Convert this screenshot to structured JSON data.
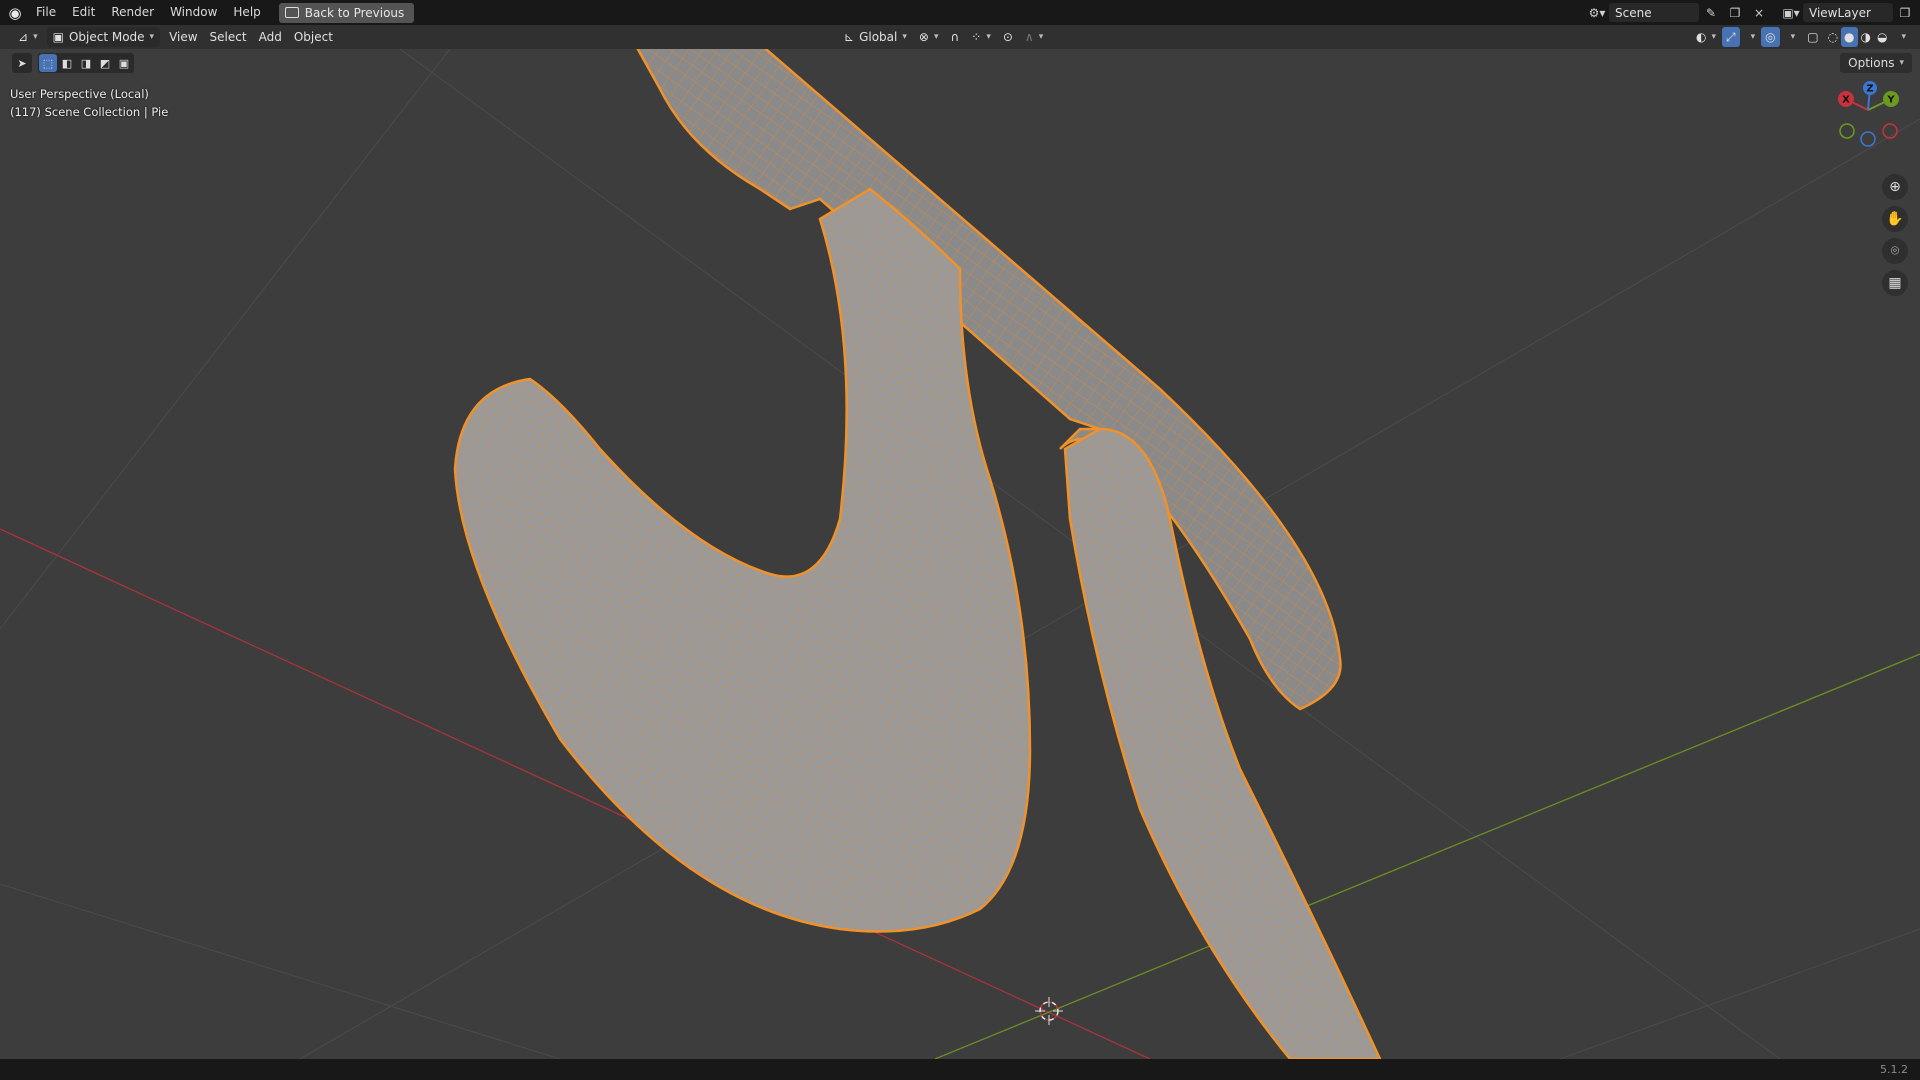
{
  "topbar": {
    "menus": [
      "File",
      "Edit",
      "Render",
      "Window",
      "Help"
    ],
    "back_label": "Back to Previous",
    "scene_label": "Scene",
    "viewlayer_label": "ViewLayer"
  },
  "header": {
    "mode_label": "Object Mode",
    "menus": [
      "View",
      "Select",
      "Add",
      "Object"
    ],
    "orientation_label": "Global",
    "options_label": "Options"
  },
  "overlay_info": {
    "perspective": "User Perspective (Local)",
    "collection": "(117) Scene Collection | Pie"
  },
  "gizmo": {
    "x": "X",
    "y": "Y",
    "z": "Z"
  },
  "status": {
    "version": "5.1.2"
  },
  "colors": {
    "accent": "#4772b3",
    "selection_outline": "#f0922b",
    "x_axis": "#c8323e",
    "y_axis": "#6c9a1f"
  }
}
